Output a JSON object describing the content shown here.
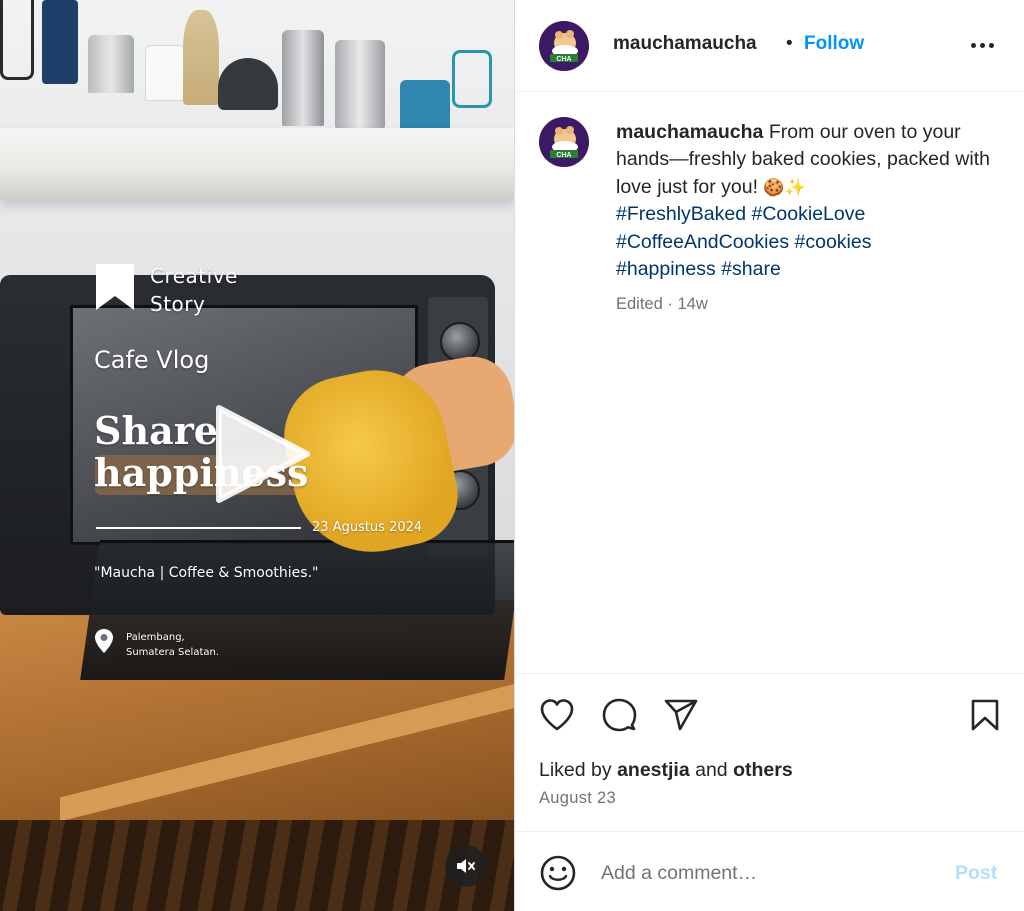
{
  "post": {
    "username": "mauchamaucha",
    "follow_label": "Follow",
    "separator": "•",
    "caption_text": " From our oven to your hands—freshly baked cookies, packed with love just for you! ",
    "caption_emoji": "🍪✨",
    "hashtags": [
      "#FreshlyBaked",
      "#CookieLove",
      "#CoffeeAndCookies",
      "#cookies",
      "#happiness",
      "#share"
    ],
    "edited_label": "Edited",
    "age": "14w",
    "liked_prefix": "Liked by ",
    "liked_user": "anestjia",
    "liked_and": " and ",
    "liked_others": "others",
    "date": "August 23",
    "comment_placeholder": "Add a comment…",
    "post_label": "Post"
  },
  "video_overlay": {
    "creative_line1": "Creative",
    "creative_line2": "Story",
    "cafe_vlog": "Cafe Vlog",
    "headline_line1": "Share",
    "headline_line2": "happiness",
    "date_text": "23 Agustus 2024",
    "quote": "\"Maucha | Coffee & Smoothies.\"",
    "location_line1": "Palembang,",
    "location_line2": "Sumatera Selatan."
  },
  "avatar_text": "CHA",
  "icons": [
    "heart-icon",
    "comment-icon",
    "share-icon",
    "bookmark-icon",
    "more-icon",
    "emoji-icon",
    "play-icon",
    "mute-icon",
    "location-pin-icon"
  ],
  "colors": {
    "follow": "#0095f6",
    "hashtag": "#00376b",
    "muted": "#737373",
    "post_disabled": "#b2dffc",
    "avatar_bg": "#3b1a63"
  }
}
